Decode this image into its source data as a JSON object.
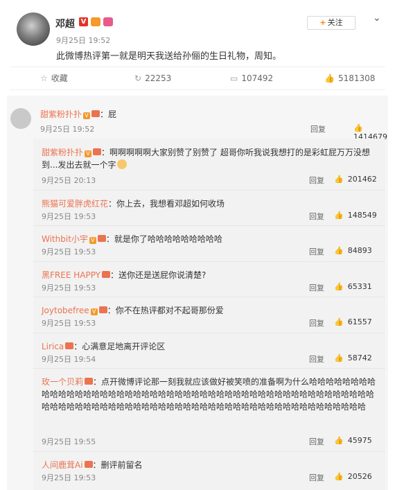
{
  "post": {
    "author": "邓超",
    "verified": "V",
    "time": "9月25日 19:52",
    "text": "此微博热评第一就是明天我送给孙俪的生日礼物，周知。",
    "follow_label": "关注",
    "follow_icon": "+",
    "more_icon": "chevron-down-icon"
  },
  "actions": {
    "collect_label": "收藏",
    "repost_count": "22253",
    "comment_count": "107492",
    "like_count": "5181308"
  },
  "top_comment": {
    "name": "甜紫粉扑扑",
    "text": "：屁",
    "time": "9月25日 19:52",
    "reply_label": "回复",
    "likes": "1414679"
  },
  "replies": [
    {
      "name": "甜紫粉扑扑",
      "text": "：啊啊啊啊啊大家别赞了别赞了 超哥你听我说我想打的是彩虹屁万万没想到...发出去就一个字",
      "time": "9月25日 20:13",
      "reply": "回复",
      "likes": "201462"
    },
    {
      "name": "熊猫可爱胖虎红花",
      "text": "：你上去，我想看邓超如何收场",
      "time": "9月25日 19:53",
      "reply": "回复",
      "likes": "148549"
    },
    {
      "name": "Withbit小宇",
      "text": "：就是你了哈哈哈哈哈哈哈哈哈",
      "time": "9月25日 19:53",
      "reply": "回复",
      "likes": "84893"
    },
    {
      "name": "黑FREE HAPPY",
      "text": "：送你还是送屁你说清楚?",
      "time": "9月25日 19:53",
      "reply": "回复",
      "likes": "65331"
    },
    {
      "name": "Joytobefree",
      "text": "：你不在热评都对不起哥那份爱",
      "time": "9月25日 19:53",
      "reply": "回复",
      "likes": "61557"
    },
    {
      "name": "Lirica",
      "text": "：心满意足地离开评论区",
      "time": "9月25日 19:54",
      "reply": "回复",
      "likes": "58742"
    },
    {
      "name": "玫一个贝莉",
      "text": "：点开微博评论那一刻我就应该做好被笑喷的准备啊为什么哈哈哈哈哈哈哈哈哈哈哈哈哈哈哈哈哈哈哈哈哈哈哈哈哈哈哈哈哈哈哈哈哈哈哈哈哈哈哈哈哈哈哈哈哈哈哈哈哈哈哈哈哈哈哈哈哈哈哈哈哈哈哈哈哈哈哈哈哈哈哈哈哈哈哈哈哈哈哈哈哈哈哈哈哈哈哈",
      "time": "9月25日 19:55",
      "reply": "回复",
      "likes": "45975"
    },
    {
      "name": "人间鹿茸Ai",
      "text": "：删评前留名",
      "time": "9月25日 19:53",
      "reply": "回复",
      "likes": "20526"
    }
  ]
}
